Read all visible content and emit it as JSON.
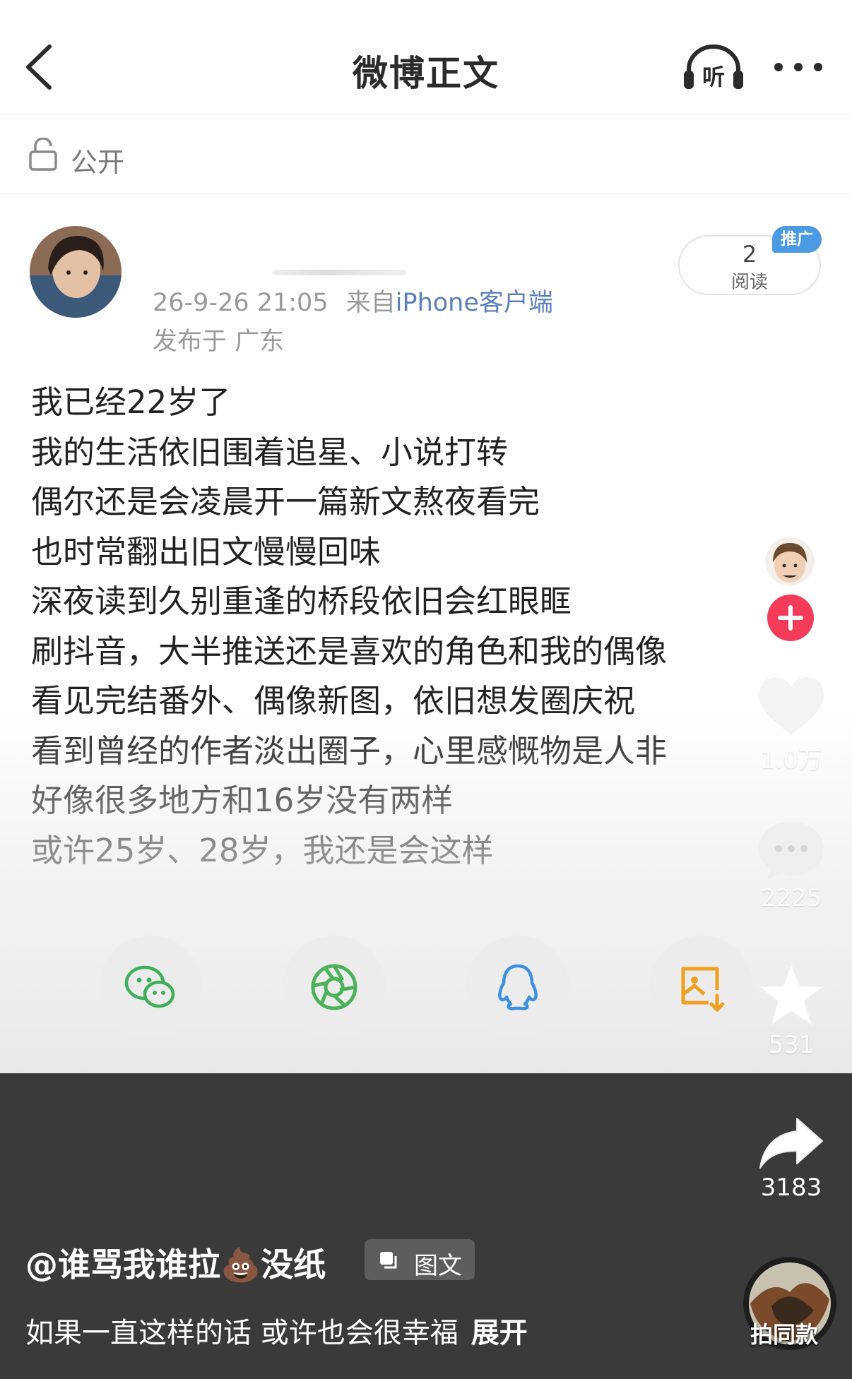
{
  "header": {
    "title": "微博正文",
    "listen_label": "听"
  },
  "visibility": {
    "label": "公开"
  },
  "post": {
    "time": "26-9-26 21:05",
    "source_prefix": "来自",
    "source": "iPhone客户端",
    "location": "发布于 广东",
    "reads": "2",
    "reads_label": "阅读",
    "promo_tag": "推广",
    "lines": [
      "我已经22岁了",
      "我的生活依旧围着追星、小说打转",
      "偶尔还是会凌晨开一篇新文熬夜看完",
      "也时常翻出旧文慢慢回味",
      "深夜读到久别重逢的桥段依旧会红眼眶",
      "刷抖音，大半推送还是喜欢的角色和我的偶像",
      "看见完结番外、偶像新图，依旧想发圈庆祝",
      "看到曾经的作者淡出圈子，心里感慨物是人非",
      "好像很多地方和16岁没有两样",
      "或许25岁、28岁，我还是会这样"
    ]
  },
  "share_targets": [
    {
      "icon": "wechat-icon",
      "color": "#3fae5a"
    },
    {
      "icon": "moments-icon",
      "color": "#4bb25a"
    },
    {
      "icon": "qq-icon",
      "color": "#3d8fe0"
    },
    {
      "icon": "save-image-icon",
      "color": "#f0a020"
    }
  ],
  "video": {
    "username": "@谁骂我谁拉💩没纸",
    "type_tag": "图文",
    "caption": "如果一直这样的话 或许也会很幸福",
    "expand": "展开",
    "likes": "1.0万",
    "comments": "2225",
    "favorites": "531",
    "shares": "3183",
    "music_label": "拍同款"
  },
  "colors": {
    "accent_blue": "#5b7fb8",
    "follow_red": "#f43b5a",
    "panel_dark": "#3a3a3a"
  }
}
